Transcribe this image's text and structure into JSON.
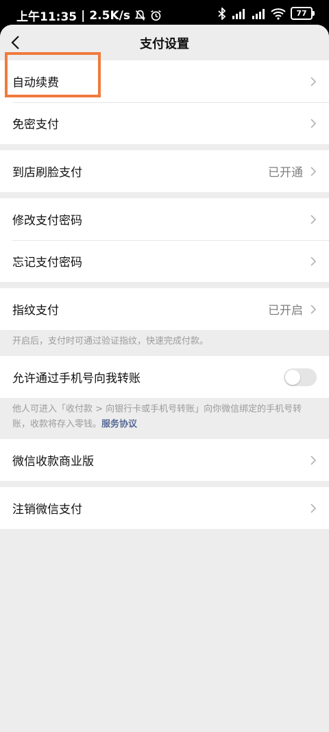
{
  "statusbar": {
    "time": "上午11:35",
    "speed": "2.5K/s",
    "battery": "77"
  },
  "nav": {
    "title": "支付设置"
  },
  "items": {
    "auto_renew": "自动续费",
    "password_free": "免密支付",
    "face_pay": "到店刷脸支付",
    "face_pay_status": "已开通",
    "change_pwd": "修改支付密码",
    "forgot_pwd": "忘记支付密码",
    "fingerprint": "指纹支付",
    "fingerprint_status": "已开启",
    "fingerprint_hint": "开启后，支付时可通过验证指纹，快速完成付款。",
    "phone_transfer": "允许通过手机号向我转账",
    "phone_transfer_hint": "他人可进入「收付款 > 向银行卡或手机号转账」向你微信绑定的手机号转账，收款将存入零钱。",
    "service_agreement": "服务协议",
    "merchant": "微信收款商业版",
    "cancel_pay": "注销微信支付"
  },
  "colors": {
    "accent_link": "#576b95",
    "highlight": "#f07a3c"
  }
}
